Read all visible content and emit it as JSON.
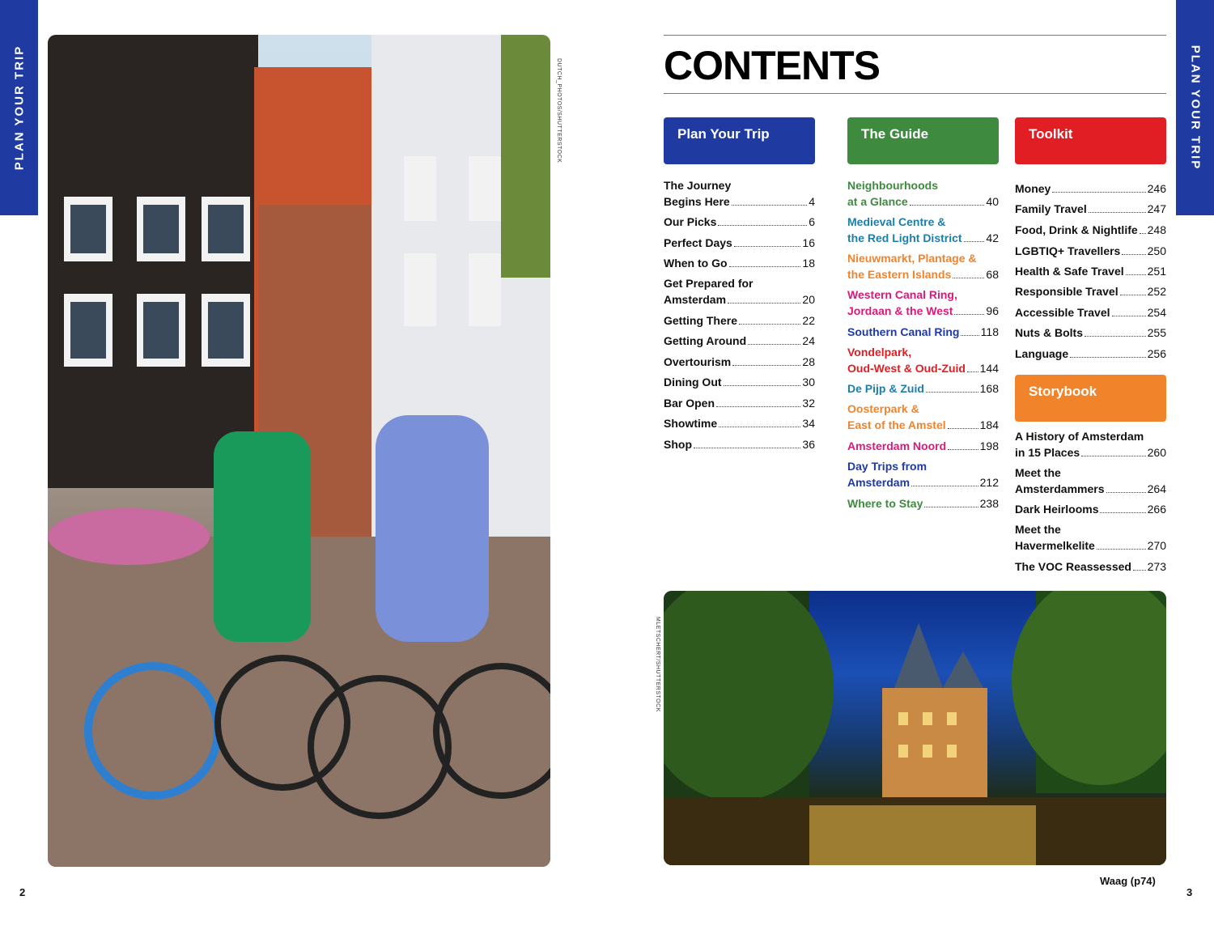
{
  "side_tab": {
    "left": "PLAN YOUR TRIP",
    "right": "PLAN YOUR TRIP"
  },
  "credits": {
    "left_photo": "DUTCH_PHOTOS/SHUTTERSTOCK",
    "bottom_photo": "MLETSCHERT/SHUTTERSTOCK"
  },
  "title": "CONTENTS",
  "sections": {
    "plan": {
      "label": "Plan Your Trip",
      "color": "#1f3aa0"
    },
    "guide": {
      "label": "The Guide",
      "color": "#3e8a3e"
    },
    "toolkit": {
      "label": "Toolkit",
      "color": "#e01e23"
    },
    "storybook": {
      "label": "Storybook",
      "color": "#f1842b"
    }
  },
  "plan_entries": [
    {
      "line1": "The Journey",
      "line2": "Begins Here",
      "page": "4"
    },
    {
      "line1": "",
      "line2": "Our Picks",
      "page": "6"
    },
    {
      "line1": "",
      "line2": "Perfect Days",
      "page": "16"
    },
    {
      "line1": "",
      "line2": "When to Go",
      "page": "18"
    },
    {
      "line1": "Get Prepared for",
      "line2": "Amsterdam",
      "page": "20"
    },
    {
      "line1": "",
      "line2": "Getting There",
      "page": "22"
    },
    {
      "line1": "",
      "line2": "Getting Around",
      "page": "24"
    },
    {
      "line1": "",
      "line2": "Overtourism",
      "page": "28"
    },
    {
      "line1": "",
      "line2": "Dining Out",
      "page": "30"
    },
    {
      "line1": "",
      "line2": "Bar Open",
      "page": "32"
    },
    {
      "line1": "",
      "line2": "Showtime",
      "page": "34"
    },
    {
      "line1": "",
      "line2": "Shop",
      "page": "36"
    }
  ],
  "guide_entries": [
    {
      "line1": "Neighbourhoods",
      "line2": "at a Glance",
      "page": "40",
      "color": "#3e8a3e"
    },
    {
      "line1": "Medieval Centre &",
      "line2": "the Red Light District",
      "page": "42",
      "color": "#1d7fa8"
    },
    {
      "line1": "Nieuwmarkt, Plantage &",
      "line2": "the Eastern Islands",
      "page": "68",
      "color": "#f1842b"
    },
    {
      "line1": "Western Canal Ring,",
      "line2": "Jordaan & the West",
      "page": "96",
      "color": "#d81b7a"
    },
    {
      "line1": "",
      "line2": "Southern Canal Ring",
      "page": "118",
      "color": "#1f3aa0"
    },
    {
      "line1": "Vondelpark,",
      "line2": "Oud-West & Oud-Zuid",
      "page": "144",
      "color": "#e01e23"
    },
    {
      "line1": "",
      "line2": "De Pijp & Zuid",
      "page": "168",
      "color": "#1d7fa8"
    },
    {
      "line1": "Oosterpark &",
      "line2": "East of the Amstel",
      "page": "184",
      "color": "#f1842b"
    },
    {
      "line1": "",
      "line2": "Amsterdam Noord",
      "page": "198",
      "color": "#d81b7a"
    },
    {
      "line1": "Day Trips from",
      "line2": "Amsterdam",
      "page": "212",
      "color": "#1f3aa0"
    },
    {
      "line1": "",
      "line2": "Where to Stay",
      "page": "238",
      "color": "#3e8a3e"
    }
  ],
  "toolkit_entries": [
    {
      "line1": "",
      "line2": "Money",
      "page": "246"
    },
    {
      "line1": "",
      "line2": "Family Travel",
      "page": "247"
    },
    {
      "line1": "",
      "line2": "Food, Drink & Nightlife",
      "page": "248"
    },
    {
      "line1": "",
      "line2": "LGBTIQ+ Travellers",
      "page": "250"
    },
    {
      "line1": "",
      "line2": "Health & Safe Travel",
      "page": "251"
    },
    {
      "line1": "",
      "line2": "Responsible Travel",
      "page": "252"
    },
    {
      "line1": "",
      "line2": "Accessible Travel",
      "page": "254"
    },
    {
      "line1": "",
      "line2": "Nuts & Bolts",
      "page": "255"
    },
    {
      "line1": "",
      "line2": "Language",
      "page": "256"
    }
  ],
  "story_entries": [
    {
      "line1": "A History of Amsterdam",
      "line2": "in 15 Places",
      "page": "260"
    },
    {
      "line1": "Meet the",
      "line2": "Amsterdammers",
      "page": "264"
    },
    {
      "line1": "",
      "line2": "Dark Heirlooms",
      "page": "266"
    },
    {
      "line1": "Meet the",
      "line2": "Havermelkelite",
      "page": "270"
    },
    {
      "line1": "",
      "line2": "The VOC Reassessed",
      "page": "273"
    }
  ],
  "caption": "Waag (p74)",
  "page_numbers": {
    "left": "2",
    "right": "3"
  }
}
